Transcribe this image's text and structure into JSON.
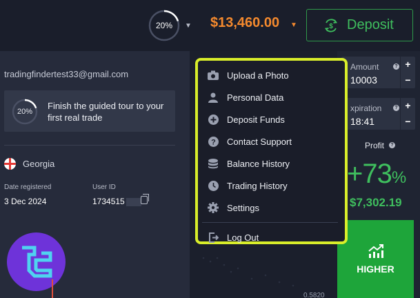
{
  "header": {
    "progress_percent": 20,
    "progress_label": "20%",
    "balance": "$13,460.00",
    "deposit_label": "Deposit"
  },
  "profile": {
    "email": "tradingfindertest33@gmail.com",
    "tour_percent_label": "20%",
    "tour_text": "Finish the guided tour to your first real trade",
    "country": "Georgia",
    "date_registered_label": "Date registered",
    "date_registered_value": "3 Dec 2024",
    "user_id_label": "User ID",
    "user_id_value": "1734515"
  },
  "menu": {
    "items": [
      {
        "label": "Upload a Photo",
        "icon": "camera-icon"
      },
      {
        "label": "Personal Data",
        "icon": "person-icon"
      },
      {
        "label": "Deposit Funds",
        "icon": "plus-circle-icon"
      },
      {
        "label": "Contact Support",
        "icon": "help-icon"
      },
      {
        "label": "Balance History",
        "icon": "database-icon"
      },
      {
        "label": "Trading History",
        "icon": "clock-icon"
      },
      {
        "label": "Settings",
        "icon": "gear-icon"
      }
    ],
    "logout_label": "Log Out"
  },
  "trade": {
    "amount_label": "Amount",
    "amount_value": "10003",
    "expiration_label": "xpiration",
    "expiration_value": "18:41",
    "profit_label": "Profit",
    "profit_percent": "+73",
    "profit_percent_sign": "%",
    "profit_amount": "$7,302.19",
    "higher_label": "HIGHER",
    "price_tick": "0.5820"
  },
  "colors": {
    "accent_orange": "#f58a2e",
    "accent_green": "#3fbf5e",
    "highlight_yellow": "#d9ee2a",
    "higher_green": "#1ea53a"
  }
}
